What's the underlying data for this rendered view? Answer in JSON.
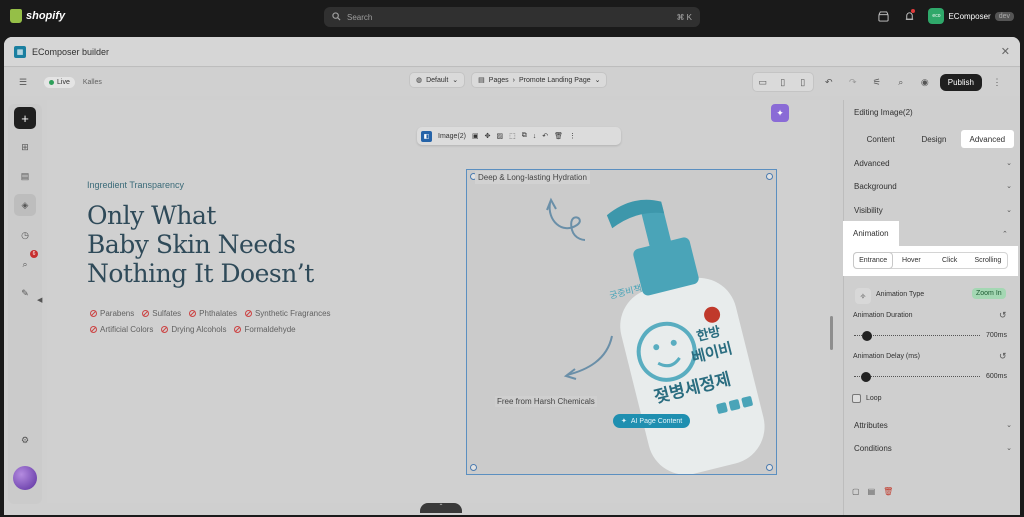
{
  "topbar": {
    "brand": "shopify",
    "search_placeholder": "Search",
    "shortcut": "⌘ K",
    "store_avatar": "eco",
    "store_name": "EComposer",
    "store_badge": "dev"
  },
  "window": {
    "title": "EComposer builder"
  },
  "toolbar": {
    "live_label": "Live",
    "theme_name": "Kalles",
    "default_label": "Default",
    "pages_label": "Pages",
    "separator": "›",
    "page_name": "Promote Landing Page",
    "publish_label": "Publish"
  },
  "leftbar": {
    "badge_count": "6"
  },
  "canvas": {
    "eyebrow": "Ingredient Transparency",
    "headline_lines": [
      "Only What",
      "Baby Skin Needs",
      "Nothing It Doesn’t"
    ],
    "free_items": [
      "Parabens",
      "Sulfates",
      "Phthalates",
      "Synthetic Fragrances",
      "Artificial Colors",
      "Drying Alcohols",
      "Formaldehyde"
    ],
    "caption_top": "Deep & Long-lasting Hydration",
    "caption_bottom": "Free from Harsh Chemicals",
    "image_toolbar_label": "Image(2)",
    "ai_button": "AI Page Content",
    "bottle_text_1": "한방",
    "bottle_text_2": "베이비",
    "bottle_text_3": "젖병세정제",
    "bottle_brand": "궁중비책"
  },
  "panel": {
    "title": "Editing Image(2)",
    "tabs": [
      {
        "label": "Content",
        "active": false
      },
      {
        "label": "Design",
        "active": false
      },
      {
        "label": "Advanced",
        "active": true
      }
    ],
    "sections": [
      "Advanced",
      "Background",
      "Visibility"
    ],
    "animation": {
      "header": "Animation",
      "tabs": [
        "Entrance",
        "Hover",
        "Click",
        "Scrolling"
      ],
      "active_tab": "Entrance",
      "type_label": "Animation Type",
      "type_value": "Zoom In",
      "duration_label": "Animation Duration",
      "duration_value": "700ms",
      "duration_fraction": 0.07,
      "delay_label": "Animation Delay (ms)",
      "delay_value": "600ms",
      "delay_fraction": 0.06,
      "loop_label": "Loop"
    },
    "bottom_sections": [
      "Attributes",
      "Conditions"
    ]
  },
  "colors": {
    "accent": "#1f8fb0",
    "headline": "#2f4a59",
    "publish_bg": "#1f1f1f",
    "zoom_badge": "#a4d7b3"
  }
}
